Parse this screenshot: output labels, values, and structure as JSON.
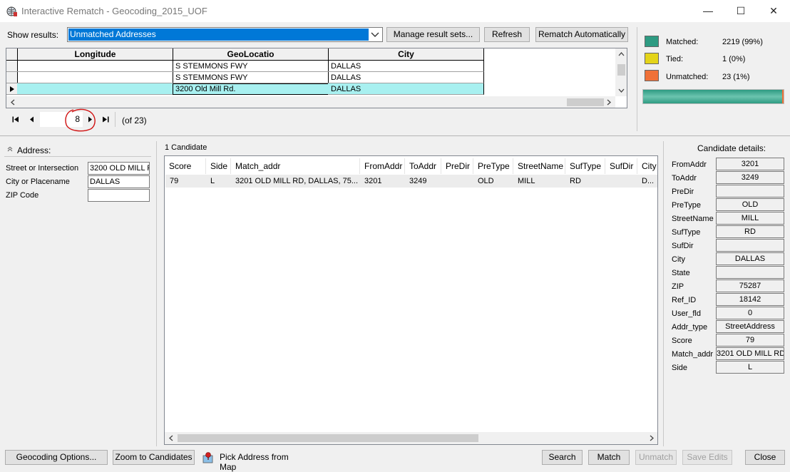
{
  "window": {
    "title": "Interactive Rematch - Geocoding_2015_UOF",
    "minimize_glyph": "—",
    "maximize_glyph": "☐",
    "close_glyph": "✕"
  },
  "toolbar": {
    "show_results_label": "Show results:",
    "show_results_value": "Unmatched Addresses",
    "manage_label": "Manage result sets...",
    "refresh_label": "Refresh",
    "rematch_label": "Rematch Automatically"
  },
  "stats": {
    "matched_label": "Matched:",
    "matched_value": "2219 (99%)",
    "tied_label": "Tied:",
    "tied_value": "1 (0%)",
    "unmatched_label": "Unmatched:",
    "unmatched_value": "23 (1%)",
    "matched_fraction": 0.99,
    "colors": {
      "matched": "#2e9b82",
      "tied": "#e4d419",
      "unmatched": "#f07138"
    }
  },
  "results_grid": {
    "columns": [
      "Longitude",
      "GeoLocatio",
      "City"
    ],
    "rows": [
      {
        "longitude": "",
        "geolocation": "S STEMMONS FWY",
        "city": "DALLAS"
      },
      {
        "longitude": "",
        "geolocation": "S STEMMONS FWY",
        "city": "DALLAS"
      },
      {
        "longitude": "",
        "geolocation": "3200 Old Mill Rd.",
        "city": "DALLAS"
      }
    ],
    "selected_row": 2,
    "selected_color": "#a8f0f0"
  },
  "pager": {
    "current": "8",
    "total": "(of 23)"
  },
  "address": {
    "title": "Address:",
    "street_label": "Street or Intersection",
    "street_value": "3200 OLD MILL R",
    "city_label": "City or Placename",
    "city_value": "DALLAS",
    "zip_label": "ZIP Code",
    "zip_value": ""
  },
  "candidates": {
    "count_label": "1 Candidate",
    "columns": [
      "Score",
      "Side",
      "Match_addr",
      "FromAddr",
      "ToAddr",
      "PreDir",
      "PreType",
      "StreetName",
      "SufType",
      "SufDir",
      "City"
    ],
    "rows": [
      [
        "79",
        "L",
        "3201 OLD MILL RD, DALLAS, 75...",
        "3201",
        "3249",
        "",
        "OLD",
        "MILL",
        "RD",
        "",
        "D..."
      ]
    ]
  },
  "details": {
    "title": "Candidate details:",
    "fields": [
      {
        "label": "FromAddr",
        "value": "3201"
      },
      {
        "label": "ToAddr",
        "value": "3249"
      },
      {
        "label": "PreDir",
        "value": ""
      },
      {
        "label": "PreType",
        "value": "OLD"
      },
      {
        "label": "StreetName",
        "value": "MILL"
      },
      {
        "label": "SufType",
        "value": "RD"
      },
      {
        "label": "SufDir",
        "value": ""
      },
      {
        "label": "City",
        "value": "DALLAS"
      },
      {
        "label": "State",
        "value": ""
      },
      {
        "label": "ZIP",
        "value": "75287"
      },
      {
        "label": "Ref_ID",
        "value": "18142"
      },
      {
        "label": "User_fld",
        "value": "0"
      },
      {
        "label": "Addr_type",
        "value": "StreetAddress"
      },
      {
        "label": "Score",
        "value": "79"
      },
      {
        "label": "Match_addr",
        "value": "3201 OLD MILL RD,"
      },
      {
        "label": "Side",
        "value": "L"
      }
    ]
  },
  "bottom": {
    "geocoding_options": "Geocoding Options...",
    "zoom_candidates": "Zoom to Candidates",
    "pick_address": "Pick Address from Map",
    "search": "Search",
    "match": "Match",
    "unmatch": "Unmatch",
    "save_edits": "Save Edits",
    "close": "Close"
  }
}
